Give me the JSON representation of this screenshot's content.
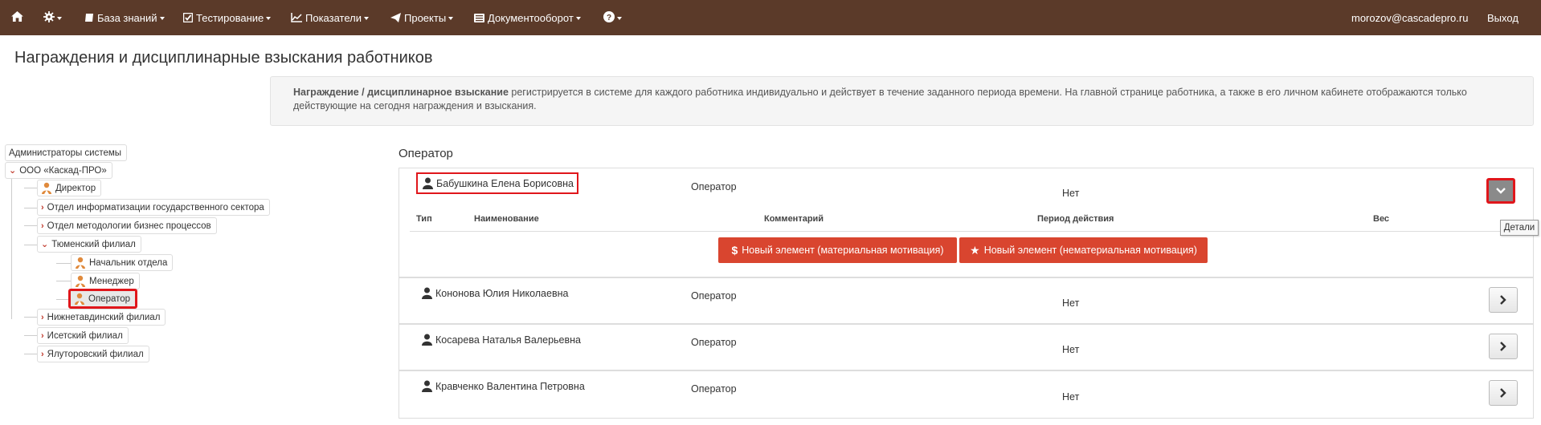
{
  "navbar": {
    "background": "#5b3a29",
    "home_icon": "home-icon",
    "settings_icon": "gear-icon",
    "items": [
      {
        "label": "База знаний",
        "icon": "book-icon"
      },
      {
        "label": "Тестирование",
        "icon": "check-square-icon"
      },
      {
        "label": "Показатели",
        "icon": "line-chart-icon"
      },
      {
        "label": "Проекты",
        "icon": "paper-plane-icon"
      },
      {
        "label": "Документооборот",
        "icon": "list-icon"
      }
    ],
    "help_icon": "question-circle-icon",
    "user_email": "morozov@cascadepro.ru",
    "logout_label": "Выход"
  },
  "page": {
    "title": "Награждения и дисциплинарные взыскания работников",
    "info_bold": "Награждение / дисциплинарное взыскание",
    "info_text_line1": " регистрируется в системе для каждого работника индивидуально и действует в течение заданного периода времени. На главной странице работника, а также в его личном кабинете отображаются только",
    "info_text_line2": "действующие на сегодня награждения и взыскания."
  },
  "tree": {
    "root": "Администраторы системы",
    "org": "ООО «Каскад-ПРО»",
    "director": "Директор",
    "dept1": "Отдел информатизации государственного сектора",
    "dept2": "Отдел методологии бизнес процессов",
    "branch_tyumen": "Тюменский филиал",
    "pos_head": "Начальник отдела",
    "pos_manager": "Менеджер",
    "pos_operator": "Оператор",
    "branch_nizhnetavdinsky": "Нижнетавдинский филиал",
    "branch_isetsky": "Исетский филиал",
    "branch_yalutorovsky": "Ялуторовский филиал"
  },
  "panel": {
    "section_title": "Оператор",
    "columns": {
      "type": "Тип",
      "name": "Наименование",
      "comment": "Комментарий",
      "period": "Период действия",
      "weight": "Вес"
    },
    "btn_material": "Новый элемент (материальная мотивация)",
    "btn_nonmaterial": "Новый элемент (нематериальная мотивация)",
    "tooltip": "Детали",
    "employees": [
      {
        "name": "Бабушкина Елена Борисовна",
        "role": "Оператор",
        "status": "Нет"
      },
      {
        "name": "Кононова Юлия Николаевна",
        "role": "Оператор",
        "status": "Нет"
      },
      {
        "name": "Косарева Наталья Валерьевна",
        "role": "Оператор",
        "status": "Нет"
      },
      {
        "name": "Кравченко Валентина Петровна",
        "role": "Оператор",
        "status": "Нет"
      }
    ]
  }
}
